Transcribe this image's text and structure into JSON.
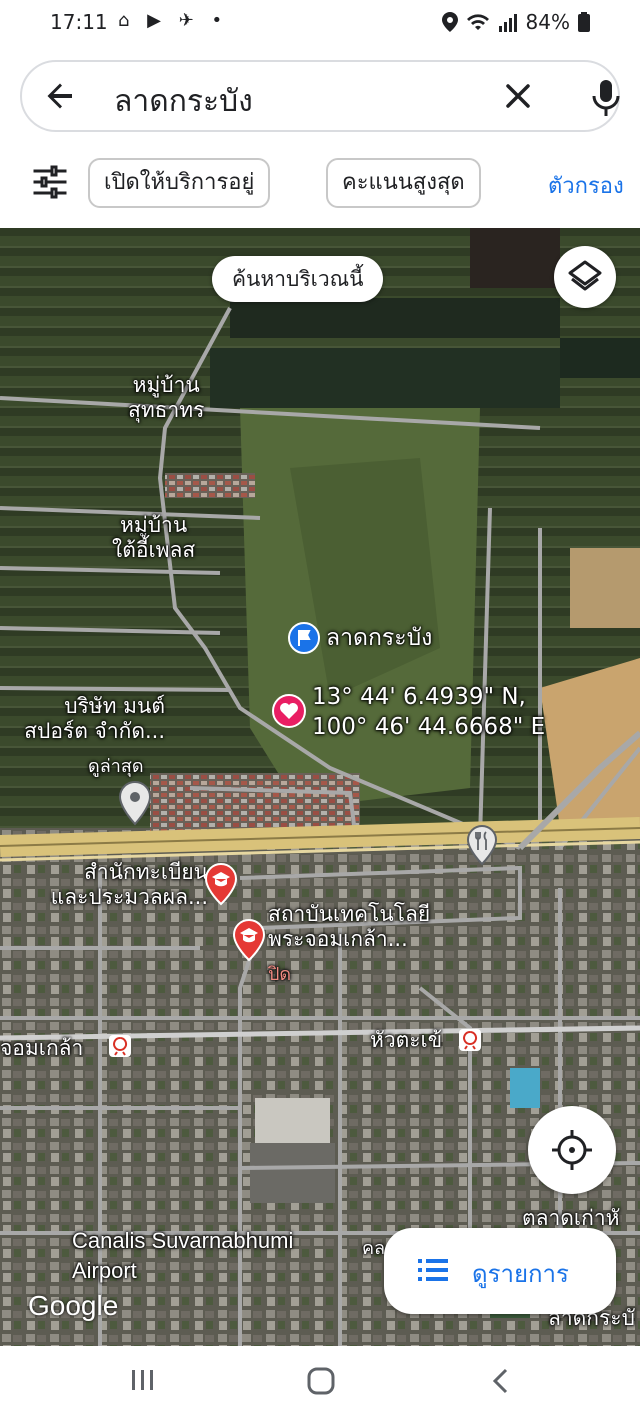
{
  "status_bar": {
    "time": "17:11",
    "notification_icons": "⌂ ▶ ✈ •",
    "battery": "84%"
  },
  "search": {
    "query": "ลาดกระบัง",
    "back_icon": "arrow-left-icon",
    "clear_icon": "close-icon",
    "mic_icon": "microphone-icon"
  },
  "chips": {
    "open_now": "เปิดให้บริการอยู่",
    "top_rated": "คะแนนสูงสุด",
    "filters": "ตัวกรอง"
  },
  "map": {
    "search_this_area": "ค้นหาบริเวณนี้",
    "labels": {
      "village_1": "หมู่บ้าน\nสุทธาทร",
      "village_2": "หมู่บ้าน\nใต้อี้เพลส",
      "place_pin": "ลาดกระบัง",
      "coords": "13° 44' 6.4939\" N,\n100° 46' 44.6668\" E",
      "company": "บริษัท มนต์\nสปอร์ต จำกัด...",
      "recent": "ดูล่าสุด",
      "registrar": "สำนักทะเบียน\nและประมวลผล...",
      "institute": "สถาบันเทคโนโลยี\nพระจอมเกล้า...",
      "closed": "ปิด",
      "station_1": "จอมเกล้า",
      "station_2": "หัวตะเข้",
      "canalis": "Canalis Suvarnabhumi\nAirport",
      "market": "ตลาดเก่าหั",
      "partial_1": "คล",
      "partial_2": "ลาดกระบั"
    },
    "google": "Google",
    "list_button": "ดูรายการ",
    "colors": {
      "road": "#a8a8a8",
      "highway": "#d9c27a",
      "pin_red": "#e53935",
      "pin_blue": "#1a73e8",
      "pin_pink": "#e91e63"
    }
  }
}
